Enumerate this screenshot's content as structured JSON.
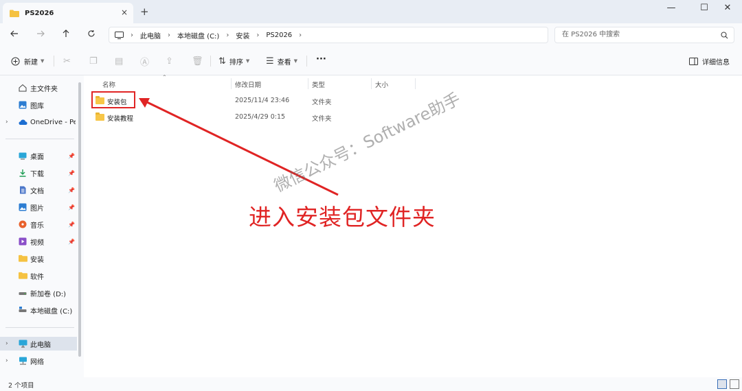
{
  "window": {
    "tab_title": "PS2026",
    "tab_close": "×",
    "new_tab": "+",
    "minimize": "—",
    "maximize": "☐",
    "close": "✕"
  },
  "nav": {
    "breadcrumb": [
      "此电脑",
      "本地磁盘 (C:)",
      "安装",
      "PS2026"
    ],
    "search_placeholder": "在 PS2026 中搜索"
  },
  "toolbar": {
    "new_label": "新建",
    "sort_label": "排序",
    "view_label": "查看",
    "more": "···",
    "details_label": "详细信息"
  },
  "sidebar": {
    "items": [
      {
        "label": "主文件夹",
        "icon": "home-icon"
      },
      {
        "label": "图库",
        "icon": "gallery-icon"
      },
      {
        "label": "OneDrive - Per",
        "icon": "cloud-icon"
      },
      {
        "label": "桌面",
        "icon": "desktop-icon"
      },
      {
        "label": "下载",
        "icon": "download-icon"
      },
      {
        "label": "文档",
        "icon": "document-icon"
      },
      {
        "label": "图片",
        "icon": "picture-icon"
      },
      {
        "label": "音乐",
        "icon": "music-icon"
      },
      {
        "label": "视频",
        "icon": "video-icon"
      },
      {
        "label": "安装",
        "icon": "folder-icon"
      },
      {
        "label": "软件",
        "icon": "folder-icon"
      },
      {
        "label": "新加卷 (D:)",
        "icon": "drive-icon"
      },
      {
        "label": "本地磁盘 (C:)",
        "icon": "drive-icon"
      },
      {
        "label": "此电脑",
        "icon": "computer-icon"
      },
      {
        "label": "网络",
        "icon": "network-icon"
      }
    ]
  },
  "columns": {
    "name": "名称",
    "date": "修改日期",
    "type": "类型",
    "size": "大小"
  },
  "files": [
    {
      "name": "安装包",
      "date": "2025/11/4 23:46",
      "type": "文件夹",
      "size": ""
    },
    {
      "name": "安装教程",
      "date": "2025/4/29 0:15",
      "type": "文件夹",
      "size": ""
    }
  ],
  "status": {
    "item_count": "2 个项目"
  },
  "annotation": {
    "text": "进入安装包文件夹",
    "watermark": "微信公众号：Software助手",
    "color": "#e02424"
  }
}
